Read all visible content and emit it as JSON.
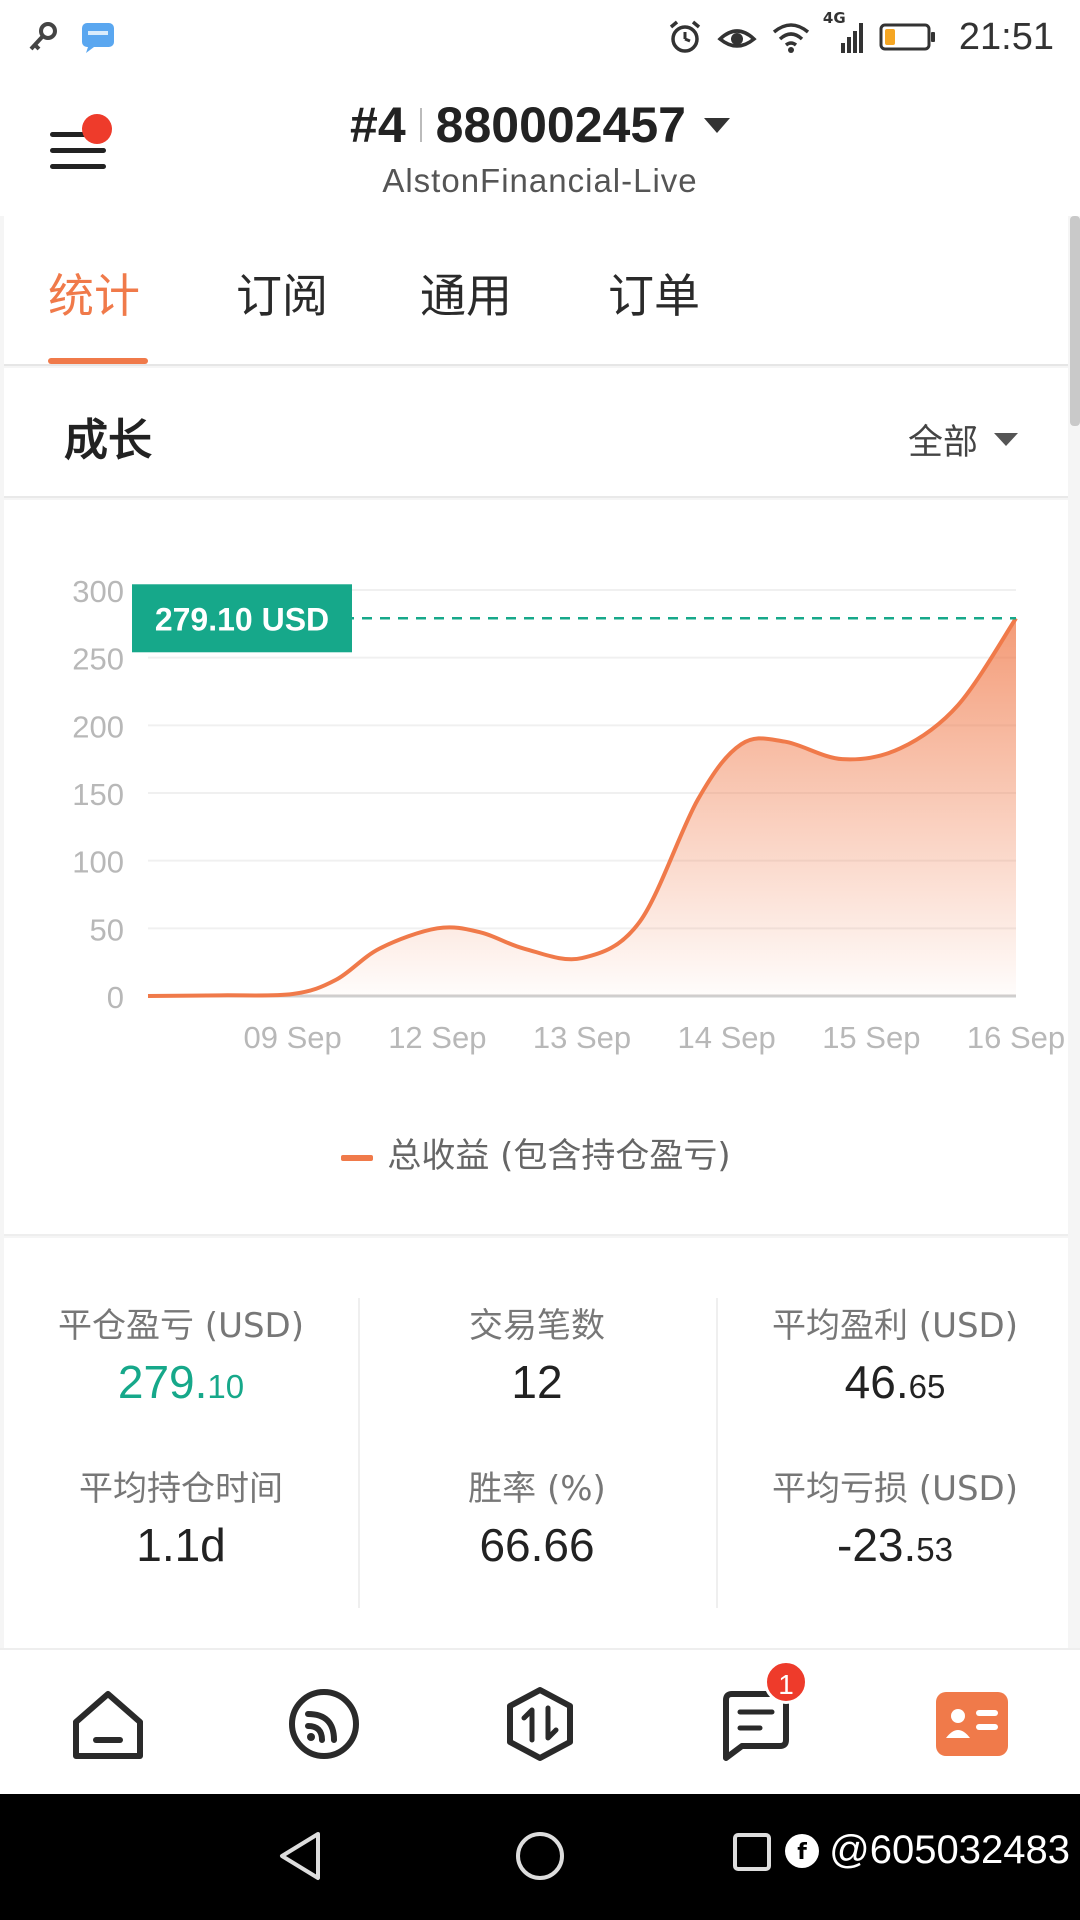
{
  "status_bar": {
    "time": "21:51",
    "network": "4G",
    "icons": [
      "key-icon",
      "message-icon",
      "alarm-icon",
      "eye-icon",
      "wifi-icon",
      "signal-icon",
      "battery-icon"
    ]
  },
  "header": {
    "account_index": "#4",
    "account_number": "880002457",
    "server": "AlstonFinancial-Live"
  },
  "tabs": [
    {
      "label": "统计",
      "active": true
    },
    {
      "label": "订阅",
      "active": false
    },
    {
      "label": "通用",
      "active": false
    },
    {
      "label": "订单",
      "active": false
    }
  ],
  "growth": {
    "title": "成长",
    "filter_label": "全部"
  },
  "chart_data": {
    "type": "area",
    "categories": [
      "",
      "09 Sep",
      "12 Sep",
      "13 Sep",
      "14 Sep",
      "15 Sep",
      "16 Sep"
    ],
    "y_ticks": [
      "300",
      "250",
      "200",
      "150",
      "100",
      "50",
      "0"
    ],
    "ylim": [
      0,
      300
    ],
    "grid": true,
    "current_value_label": "279.10 USD",
    "current_value": 279.1,
    "series": [
      {
        "name": "总收益 (包含持仓盈亏)",
        "color": "#f07a4a",
        "points": [
          [
            0,
            0
          ],
          [
            0.5,
            0.5
          ],
          [
            1,
            1.5
          ],
          [
            1.3,
            12
          ],
          [
            1.6,
            35
          ],
          [
            2,
            50
          ],
          [
            2.3,
            47
          ],
          [
            2.6,
            35
          ],
          [
            3,
            28
          ],
          [
            3.4,
            55
          ],
          [
            3.8,
            145
          ],
          [
            4.1,
            186
          ],
          [
            4.4,
            188
          ],
          [
            4.8,
            175
          ],
          [
            5.2,
            183
          ],
          [
            5.6,
            215
          ],
          [
            6,
            279.1
          ]
        ]
      }
    ],
    "legend": "总收益 (包含持仓盈亏)",
    "accent_color": "#16a88a"
  },
  "stats": {
    "closed_pnl": {
      "label": "平仓盈亏 (USD)",
      "int": "279.",
      "dec": "10"
    },
    "trades": {
      "label": "交易笔数",
      "value": "12"
    },
    "avg_profit": {
      "label": "平均盈利 (USD)",
      "int": "46.",
      "dec": "65"
    },
    "avg_hold": {
      "label": "平均持仓时间",
      "value": "1.1d"
    },
    "win_rate": {
      "label": "胜率 (%)",
      "value": "66.66"
    },
    "avg_loss": {
      "label": "平均亏损 (USD)",
      "int": "-23.",
      "dec": "53"
    }
  },
  "bottom_nav": {
    "items": [
      "home-icon",
      "feed-icon",
      "trade-icon",
      "messages-icon",
      "profile-icon"
    ],
    "messages_badge": "1",
    "active": "profile-icon"
  },
  "watermark": "@605032483"
}
